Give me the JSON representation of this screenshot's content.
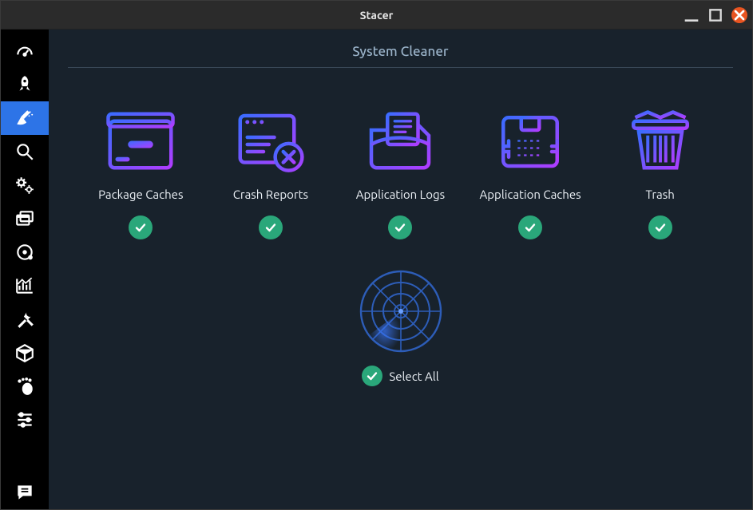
{
  "window": {
    "title": "Stacer"
  },
  "page": {
    "title": "System Cleaner",
    "select_all": "Select All"
  },
  "categories": [
    {
      "label": "Package Caches",
      "checked": true
    },
    {
      "label": "Crash Reports",
      "checked": true
    },
    {
      "label": "Application Logs",
      "checked": true
    },
    {
      "label": "Application Caches",
      "checked": true
    },
    {
      "label": "Trash",
      "checked": true
    }
  ],
  "sidebar": {
    "items": [
      {
        "name": "dashboard",
        "active": false
      },
      {
        "name": "startup",
        "active": false
      },
      {
        "name": "cleaner",
        "active": true
      },
      {
        "name": "search",
        "active": false
      },
      {
        "name": "services",
        "active": false
      },
      {
        "name": "processes",
        "active": false
      },
      {
        "name": "uninstaller",
        "active": false
      },
      {
        "name": "resources",
        "active": false
      },
      {
        "name": "helpers",
        "active": false
      },
      {
        "name": "apt-repos",
        "active": false
      },
      {
        "name": "gnome",
        "active": false
      },
      {
        "name": "settings",
        "active": false
      },
      {
        "name": "feedback",
        "active": false
      }
    ]
  },
  "colors": {
    "grad_start": "#3a6cff",
    "grad_end": "#b03cff",
    "accent": "#2d74e7",
    "check": "#2aa77a",
    "bg": "#18222c"
  }
}
